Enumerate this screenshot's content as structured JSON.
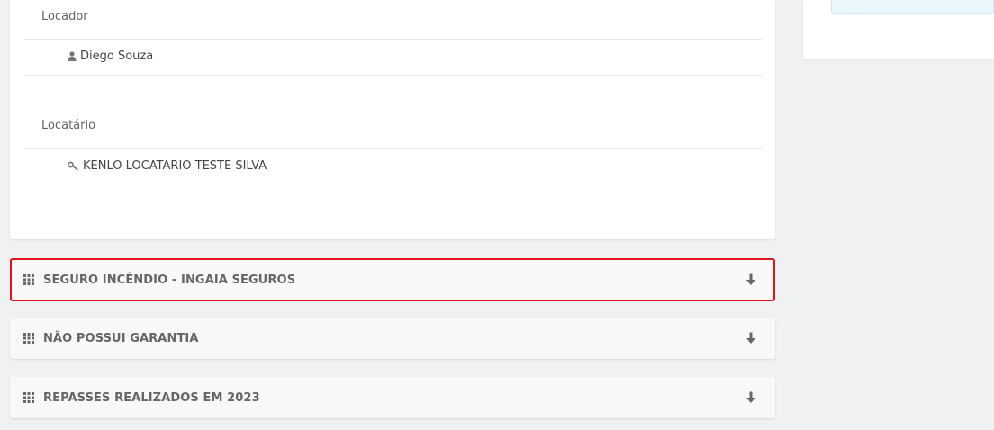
{
  "parties": {
    "landlord_label": "Locador",
    "landlord_name": "Diego Souza",
    "tenant_label": "Locatário",
    "tenant_name": "KENLO LOCATARIO TESTE SILVA"
  },
  "accordions": [
    {
      "title": "SEGURO INCÊNDIO - INGAIA SEGUROS",
      "highlighted": true
    },
    {
      "title": "NÃO POSSUI GARANTIA",
      "highlighted": false
    },
    {
      "title": "REPASSES REALIZADOS EM 2023",
      "highlighted": false
    }
  ],
  "icons": {
    "landlord": "user-icon",
    "tenant": "key-icon",
    "panel": "grid-icon",
    "expand": "arrow-down-icon"
  },
  "colors": {
    "highlight_border": "#e0141b",
    "background": "#f0f1f3",
    "info_box": "#e9f6fb"
  }
}
